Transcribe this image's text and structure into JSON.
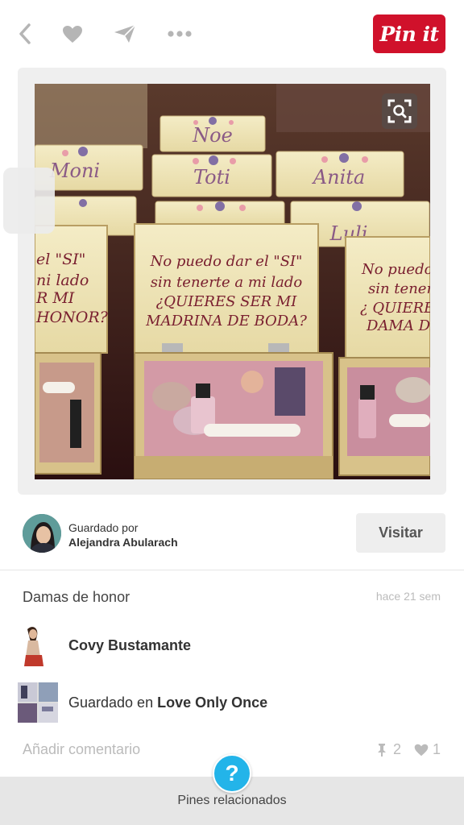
{
  "toolbar": {
    "back_icon": "chevron-left-icon",
    "like_icon": "heart-icon",
    "send_icon": "paper-plane-icon",
    "more_icon": "ellipsis-icon",
    "pinit_label": "Pin it",
    "pinit_color": "#d0112b"
  },
  "image": {
    "box_labels": [
      "Noe",
      "Moni",
      "Toti",
      "Anita",
      "Luli"
    ],
    "card_center": [
      "No puedo dar el \"SI\"",
      "sin tenerte a mi lado",
      "¿QUIERES SER MI",
      "MADRINA DE BODA?"
    ],
    "card_left": [
      "el \"SI\"",
      "ni lado",
      "R MI",
      "HONOR?"
    ],
    "card_right": [
      "No puedo",
      "sin tenert",
      "¿ QUIERES",
      "DAMA DE"
    ],
    "zoom_icon": "visual-search-icon"
  },
  "saved_by": {
    "prefix": "Guardado por",
    "name": "Alejandra Abularach",
    "visit_label": "Visitar"
  },
  "pin": {
    "description": "Damas de honor",
    "time": "hace 21 sem",
    "pinner": "Covy Bustamante",
    "board_prefix": "Guardado en",
    "board_name": "Love Only Once",
    "comment_placeholder": "Añadir comentario",
    "repins": "2",
    "likes": "1"
  },
  "bottom": {
    "help_label": "?",
    "related_label": "Pines relacionados"
  }
}
